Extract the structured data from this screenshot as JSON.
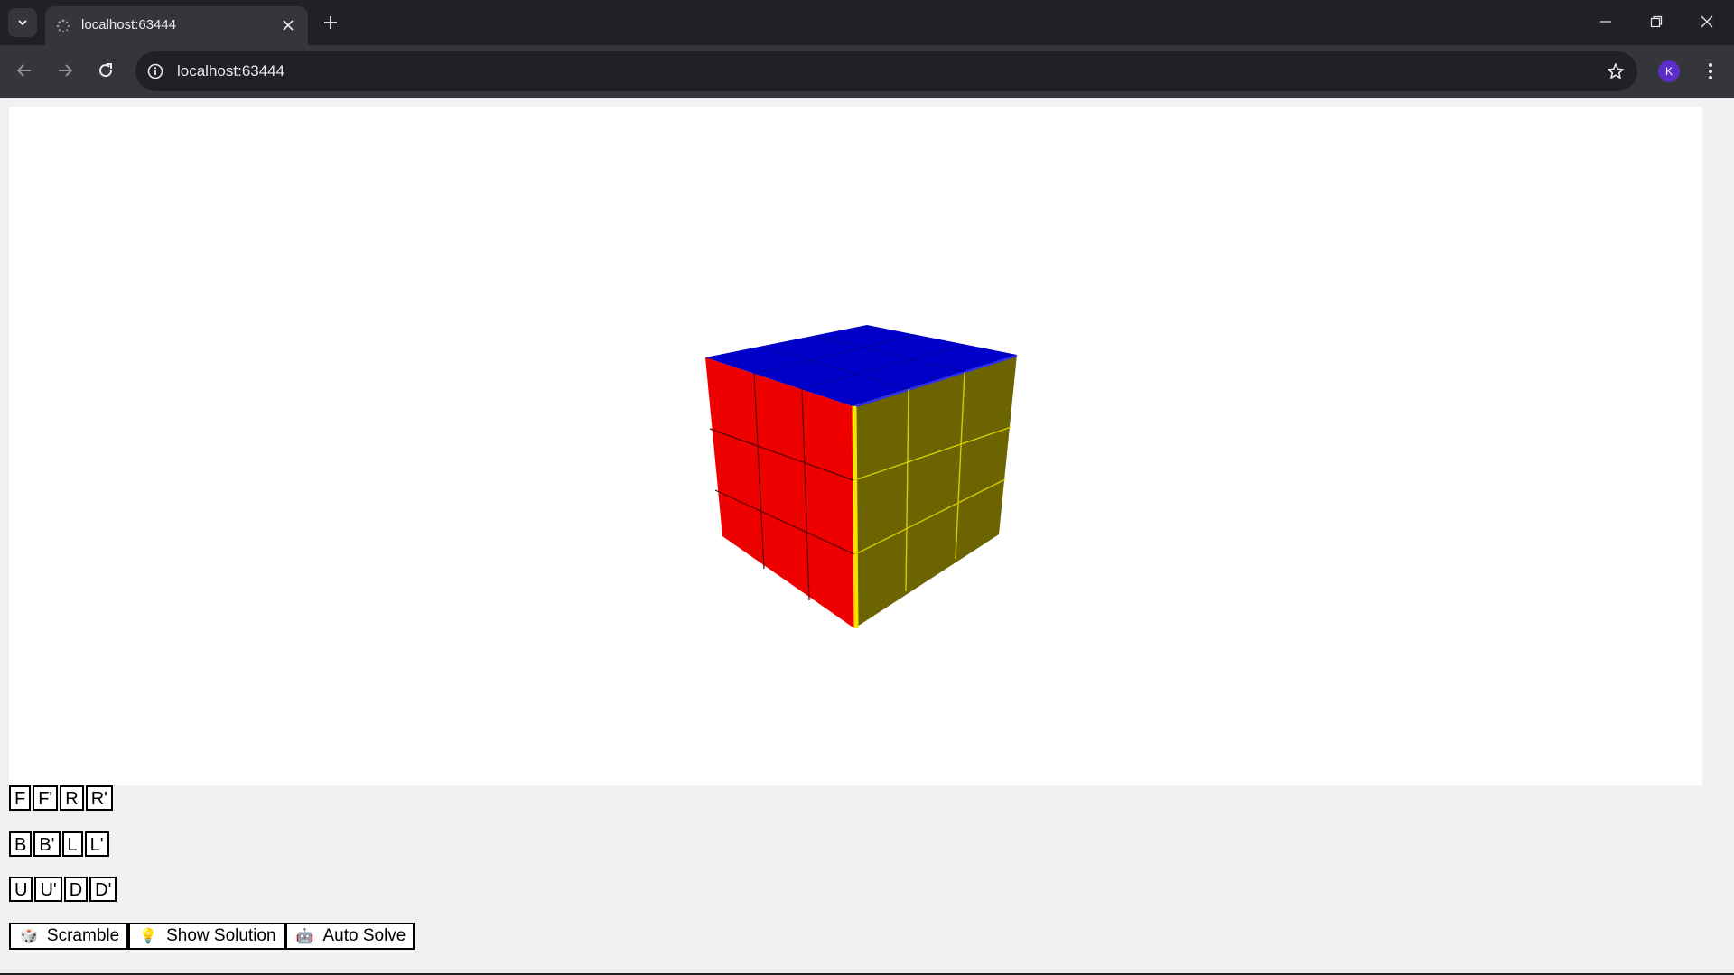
{
  "browser": {
    "tab_title": "localhost:63444",
    "url": "localhost:63444",
    "profile_initial": "K",
    "icons": {
      "tab_search": "chevron-down-icon",
      "favicon": "loading-spinner-icon",
      "tab_close": "close-icon",
      "new_tab": "plus-icon",
      "minimize": "minimize-icon",
      "restore": "restore-icon",
      "close_window": "close-icon",
      "back": "arrow-left-icon",
      "forward": "arrow-right-icon",
      "reload": "reload-icon",
      "site_info": "info-icon",
      "bookmark": "star-icon",
      "menu": "kebab-menu-icon"
    },
    "colors": {
      "chrome_dark": "#202124",
      "chrome_toolbar": "#35363a",
      "profile_bg": "#5b2ec9"
    }
  },
  "cube": {
    "faces": {
      "top": "blue",
      "left": "red",
      "right": "yellow"
    },
    "colors": {
      "blue": "#0000c8",
      "red": "#ee0000",
      "yellow": "#6b6400",
      "yellow_edge": "#f5e400",
      "grid_line": "#222222"
    }
  },
  "controls": {
    "row1": [
      "F",
      "F'",
      "R",
      "R'"
    ],
    "row2": [
      "B",
      "B'",
      "L",
      "L'"
    ],
    "row3": [
      "U",
      "U'",
      "D",
      "D'"
    ],
    "actions": {
      "scramble": {
        "label": "Scramble",
        "icon": "dice-icon",
        "glyph": "🎲"
      },
      "show_solution": {
        "label": "Show Solution",
        "icon": "lightbulb-icon",
        "glyph": "💡"
      },
      "auto_solve": {
        "label": "Auto Solve",
        "icon": "robot-icon",
        "glyph": "🤖"
      }
    }
  }
}
